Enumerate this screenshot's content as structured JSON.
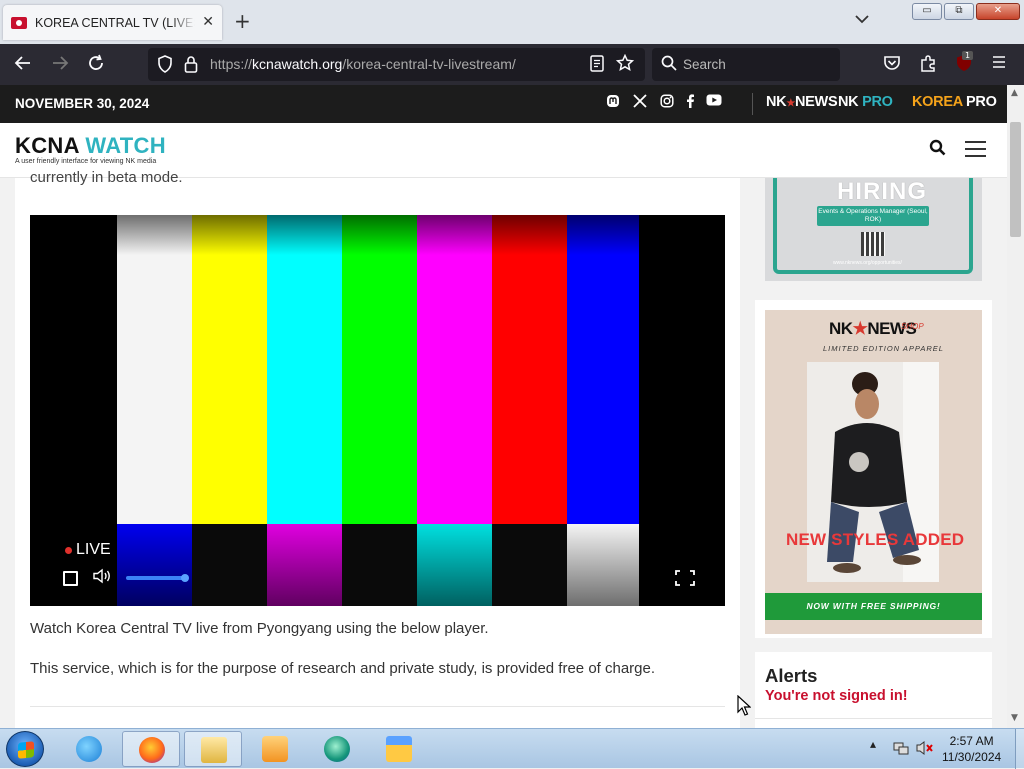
{
  "browser": {
    "tab_title": "KOREA CENTRAL TV (LIVESTREAM)",
    "tab_close": "✕",
    "new_tab": "+",
    "url_prefix": "https://",
    "url_host": "kcnawatch.org",
    "url_path": "/korea-central-tv-livestream/",
    "search_placeholder": "Search",
    "extension_badge": "1",
    "window_buttons": {
      "minimize": "▭",
      "maximize": "⧉",
      "close": "✕"
    }
  },
  "site": {
    "date": "NOVEMBER 30, 2024",
    "brands": [
      {
        "lead": "NK",
        "star": "★",
        "rest": "NEWS",
        "color": "#ffffff"
      },
      {
        "lead": "NK",
        "star": "",
        "rest": " PRO",
        "color": "#2fb3c0"
      },
      {
        "lead": "KOREA",
        "star": "",
        "rest": " PRO",
        "color": "#f5a31a"
      }
    ],
    "logo_main": "KCNA ",
    "logo_accent": "WATCH",
    "logo_tagline": "A user friendly interface for viewing NK media"
  },
  "article": {
    "beta_text": "currently in beta mode.",
    "player_live_label": "LIVE",
    "player_volume": 0.9,
    "paragraph_1": "Watch Korea Central TV live from Pyongyang using the below player.",
    "paragraph_2": "This service, which is for the purpose of research and private study, is provided free of charge."
  },
  "sidebar": {
    "ad1": {
      "headline": "HIRING",
      "role": "Events & Operations Manager (Seoul, ROK)",
      "url": "www.nknews.org/opportunities/"
    },
    "ad2": {
      "brand_lead": "NK",
      "brand_star": "★",
      "brand_rest": "NEWS",
      "brand_shop": "SHOP",
      "subtitle": "LIMITED EDITION APPAREL",
      "headline": "NEW STYLES ADDED",
      "shipping": "NOW WITH FREE SHIPPING!"
    },
    "alerts": {
      "title": "Alerts",
      "subtitle": "You're not signed in!"
    }
  },
  "colors": {
    "accent": "#2fb3c0",
    "alert_red": "#c8102e",
    "ad_green": "#2ba58f",
    "ship_green": "#1f9a3a"
  },
  "taskbar": {
    "time": "2:57 AM",
    "date": "11/30/2024",
    "apps": [
      "internet-explorer",
      "firefox",
      "file-explorer",
      "media-player",
      "chat-app",
      "floppy-app"
    ]
  }
}
